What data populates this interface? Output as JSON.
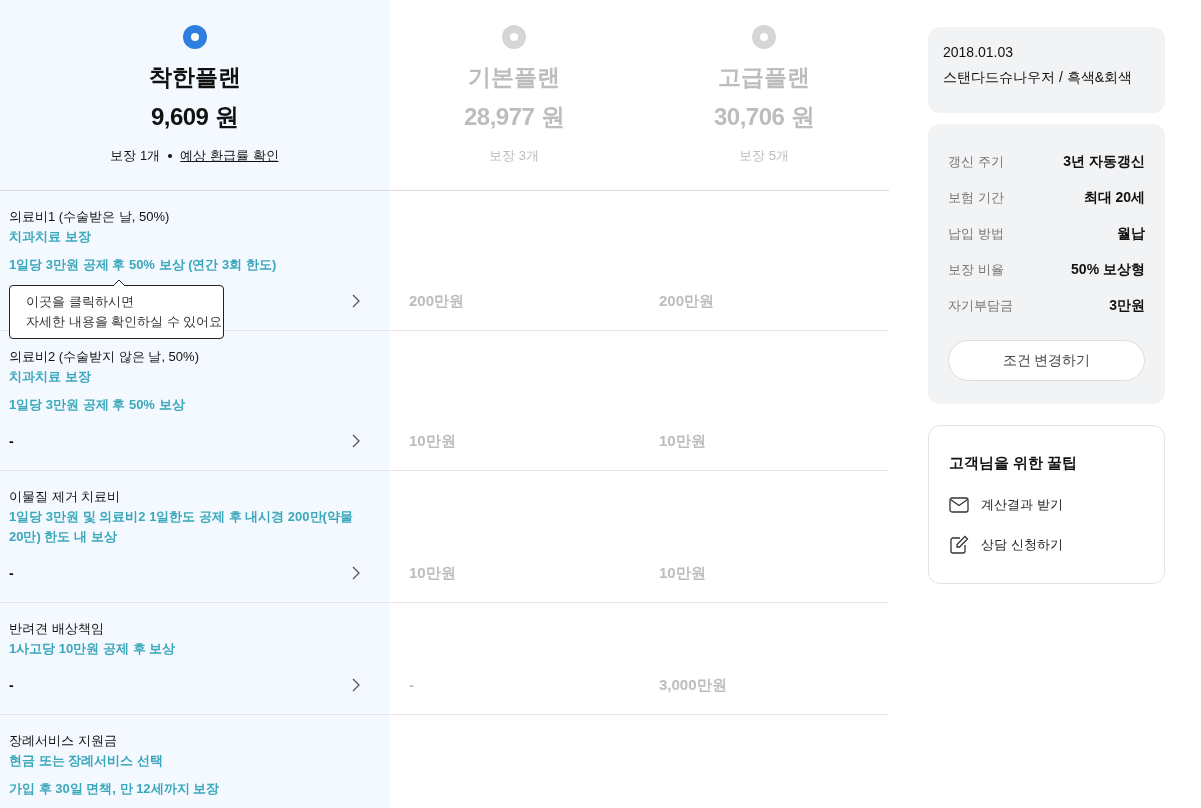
{
  "plans": [
    {
      "name": "착한플랜",
      "price": "9,609 원",
      "coverage": "보장 1개",
      "link": "예상 환급률 확인",
      "selected": true
    },
    {
      "name": "기본플랜",
      "price": "28,977 원",
      "coverage": "보장 3개",
      "selected": false
    },
    {
      "name": "고급플랜",
      "price": "30,706 원",
      "coverage": "보장 5개",
      "selected": false
    }
  ],
  "rows": [
    {
      "name": "의료비1 (수술받은 날, 50%)",
      "desc": "치과치료 보장",
      "detail": "1일당 3만원 공제 후 50% 보상 (연간 3회 한도)",
      "plan_values": [
        "200만원",
        "200만원"
      ],
      "tooltip": [
        "이곳을 클릭하시면",
        "자세한 내용을 확인하실 수 있어요"
      ]
    },
    {
      "name": "의료비2 (수술받지 않은 날, 50%)",
      "desc": "치과치료 보장",
      "detail": "1일당 3만원 공제 후 50% 보상",
      "value": "-",
      "plan_values": [
        "10만원",
        "10만원"
      ]
    },
    {
      "name": "이물질 제거 치료비",
      "desc": "1일당 3만원 및 의료비2 1일한도 공제 후 내시경 200만(약물 20만) 한도 내 보상",
      "value": "-",
      "plan_values": [
        "10만원",
        "10만원"
      ]
    },
    {
      "name": "반려견 배상책임",
      "desc": "1사고당 10만원 공제 후 보상",
      "value": "-",
      "plan_values": [
        "-",
        "3,000만원"
      ]
    },
    {
      "name": "장례서비스 지원금",
      "desc": "현금 또는 장례서비스 선택",
      "detail": "가입 후 30일 면책, 만 12세까지 보장"
    }
  ],
  "pet": {
    "birth_date": "2018.01.03",
    "breed": "스탠다드슈나우저 / 흑색&회색"
  },
  "conditions": [
    {
      "label": "갱신 주기",
      "value": "3년 자동갱신"
    },
    {
      "label": "보험 기간",
      "value": "최대 20세"
    },
    {
      "label": "납입 방법",
      "value": "월납"
    },
    {
      "label": "보장 비율",
      "value": "50% 보상형"
    },
    {
      "label": "자기부담금",
      "value": "3만원"
    }
  ],
  "change_button": "조건 변경하기",
  "tips": {
    "title": "고객님을 위한 꿀팁",
    "items": [
      {
        "kind": "mail",
        "label": "계산결과 받기"
      },
      {
        "kind": "edit",
        "label": "상담 신청하기"
      }
    ]
  }
}
